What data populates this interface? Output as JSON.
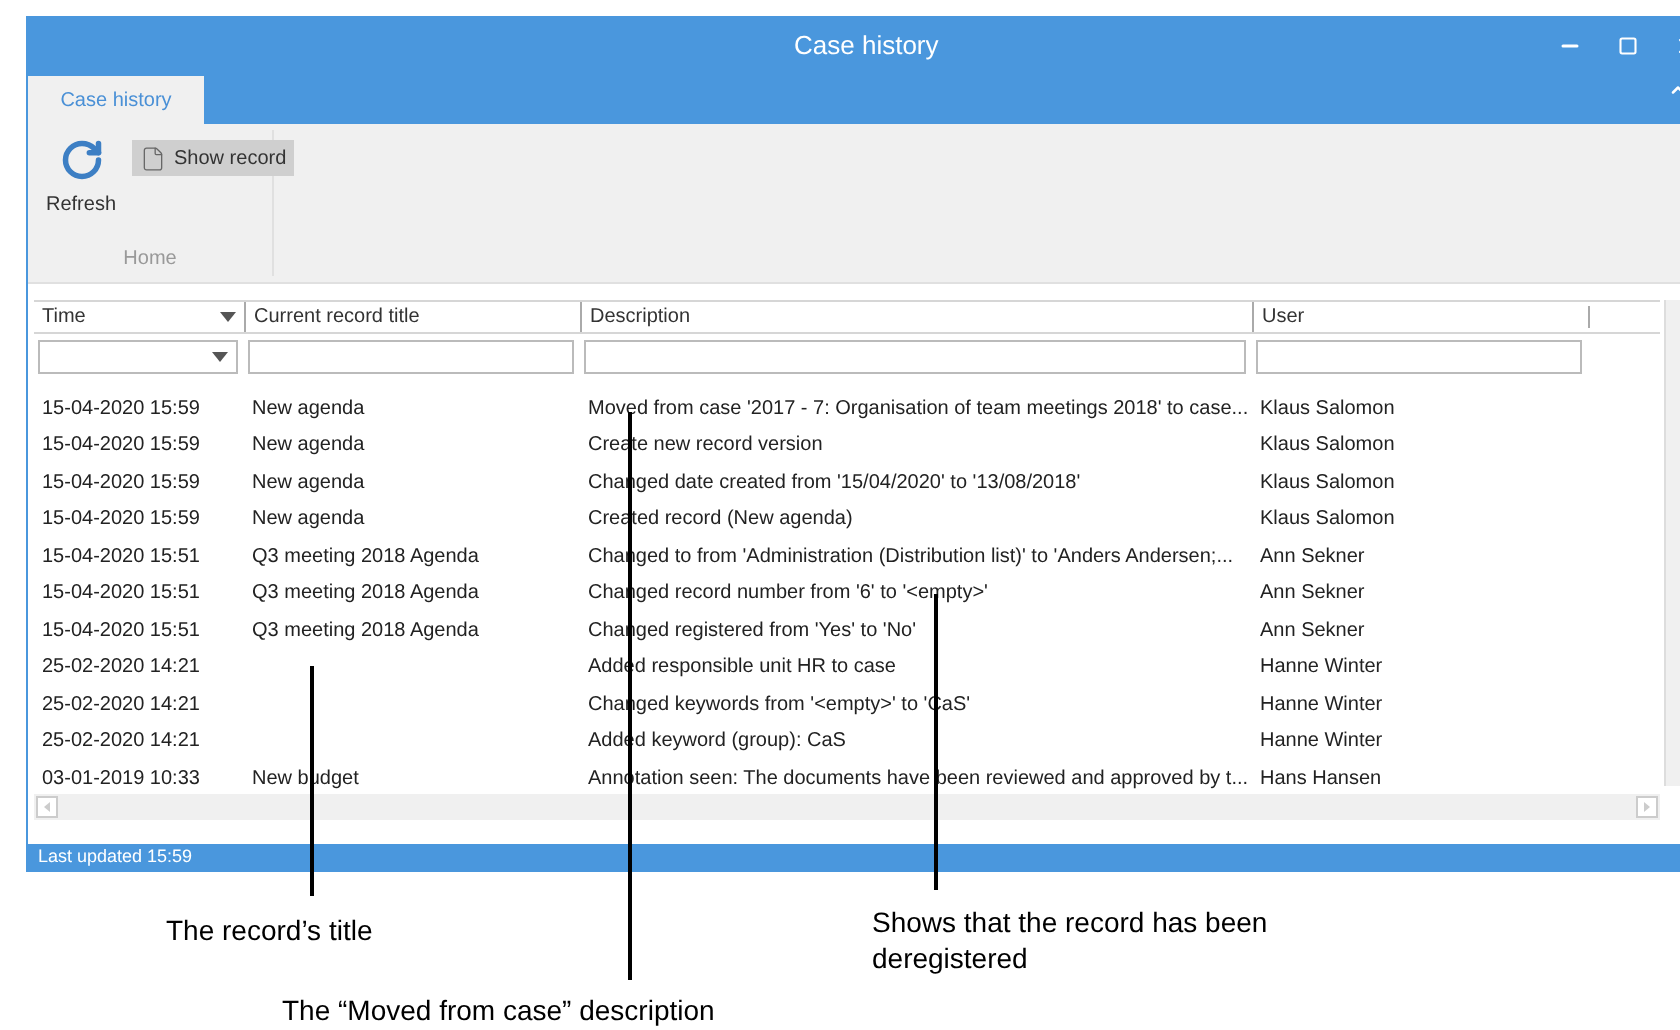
{
  "window": {
    "title": "Case history"
  },
  "tabs": [
    {
      "label": "Case history",
      "selected": true
    }
  ],
  "ribbon": {
    "group_label": "Home",
    "buttons": [
      {
        "label": "Refresh",
        "kind": "large",
        "pressed": false
      },
      {
        "label": "Show record",
        "kind": "small",
        "pressed": true
      }
    ]
  },
  "table": {
    "columns": [
      {
        "label": "Time",
        "dropdown_filter": true
      },
      {
        "label": "Current record title",
        "dropdown_filter": false
      },
      {
        "label": "Description",
        "dropdown_filter": false
      },
      {
        "label": "User",
        "dropdown_filter": false
      }
    ],
    "rows": [
      [
        "15-04-2020 15:59",
        "New agenda",
        "Moved from case '2017 - 7: Organisation of team meetings 2018' to case...",
        "Klaus Salomon"
      ],
      [
        "15-04-2020 15:59",
        "New agenda",
        "Create new record version",
        "Klaus Salomon"
      ],
      [
        "15-04-2020 15:59",
        "New agenda",
        "Changed date created from '15/04/2020' to '13/08/2018'",
        "Klaus Salomon"
      ],
      [
        "15-04-2020 15:59",
        "New agenda",
        "Created record (New agenda)",
        "Klaus Salomon"
      ],
      [
        "15-04-2020 15:51",
        "Q3 meeting 2018 Agenda",
        "Changed to from 'Administration (Distribution list)' to 'Anders Andersen;...",
        "Ann Sekner"
      ],
      [
        "15-04-2020 15:51",
        "Q3 meeting 2018 Agenda",
        "Changed record number from '6' to '<empty>'",
        "Ann Sekner"
      ],
      [
        "15-04-2020 15:51",
        "Q3 meeting 2018 Agenda",
        "Changed registered from 'Yes' to 'No'",
        "Ann Sekner"
      ],
      [
        "25-02-2020 14:21",
        "",
        "Added responsible unit HR to case",
        "Hanne Winter"
      ],
      [
        "25-02-2020 14:21",
        "",
        "Changed keywords from '<empty>' to 'CaS'",
        "Hanne Winter"
      ],
      [
        "25-02-2020 14:21",
        "",
        "Added keyword (group): CaS",
        "Hanne Winter"
      ],
      [
        "03-01-2019 10:33",
        "New budget",
        "Annotation seen: The documents have been reviewed and approved by t...",
        "Hans Hansen"
      ]
    ]
  },
  "status_bar": "Last updated 15:59",
  "annotations": [
    {
      "text": "The record’s title"
    },
    {
      "text": "The “Moved from case” description"
    },
    {
      "text": "Shows that the record has been deregistered"
    }
  ]
}
